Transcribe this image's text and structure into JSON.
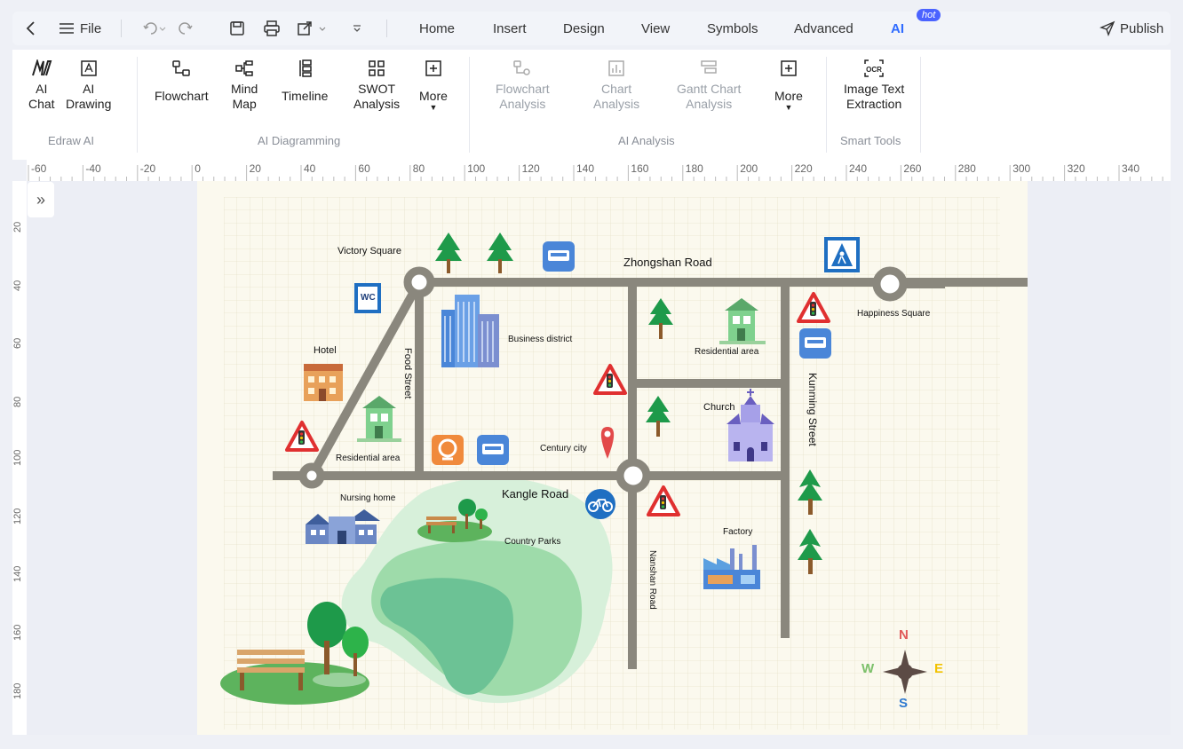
{
  "toolbar": {
    "file_label": "File",
    "menus": [
      "Home",
      "Insert",
      "Design",
      "View",
      "Symbols",
      "Advanced",
      "AI"
    ],
    "hot_badge": "hot",
    "publish_label": "Publish"
  },
  "ribbon": {
    "edraw_ai": {
      "group": "Edraw AI",
      "ai_chat": [
        "AI",
        "Chat"
      ],
      "ai_drawing": [
        "AI",
        "Drawing"
      ]
    },
    "ai_diagramming": {
      "group": "AI Diagramming",
      "flowchart": "Flowchart",
      "mind_map": [
        "Mind",
        "Map"
      ],
      "timeline": "Timeline",
      "swot": [
        "SWOT",
        "Analysis"
      ],
      "more": "More"
    },
    "ai_analysis": {
      "group": "AI Analysis",
      "flowchart_analysis": [
        "Flowchart",
        "Analysis"
      ],
      "chart_analysis": [
        "Chart",
        "Analysis"
      ],
      "gantt_analysis": [
        "Gantt Chart",
        "Analysis"
      ],
      "more": "More"
    },
    "smart_tools": {
      "group": "Smart Tools",
      "ocr": [
        "Image Text",
        "Extraction"
      ]
    }
  },
  "ruler_h": [
    "-60",
    "-40",
    "-20",
    "0",
    "20",
    "40",
    "60",
    "80",
    "100",
    "120",
    "140",
    "160",
    "180",
    "200",
    "220",
    "240",
    "260",
    "280",
    "300",
    "320",
    "340"
  ],
  "ruler_v": [
    "20",
    "40",
    "60",
    "80",
    "100",
    "120",
    "140",
    "160",
    "180"
  ],
  "map": {
    "labels": {
      "victory_square": "Victory Square",
      "zhongshan_road": "Zhongshan Road",
      "happiness_square": "Happiness Square",
      "hotel": "Hotel",
      "food_street": "Food Street",
      "business_district": "Business district",
      "residential_area_1": "Residential area",
      "residential_area_2": "Residential area",
      "church": "Church",
      "kunming_street": "Kunming Street",
      "century_city": "Century city",
      "kangle_road": "Kangle Road",
      "nursing_home": "Nursing home",
      "country_parks": "Country Parks",
      "factory": "Factory",
      "nanshan_road": "Nanshan Road",
      "wc": "WC",
      "compass_n": "N",
      "compass_s": "S",
      "compass_w": "W",
      "compass_e": "E"
    },
    "colors": {
      "road": "#8a877d",
      "tree": "#1e9a4a",
      "bus_sign": "#4a86d8",
      "warning": "#e03030",
      "pin": "#e24a4a"
    }
  }
}
